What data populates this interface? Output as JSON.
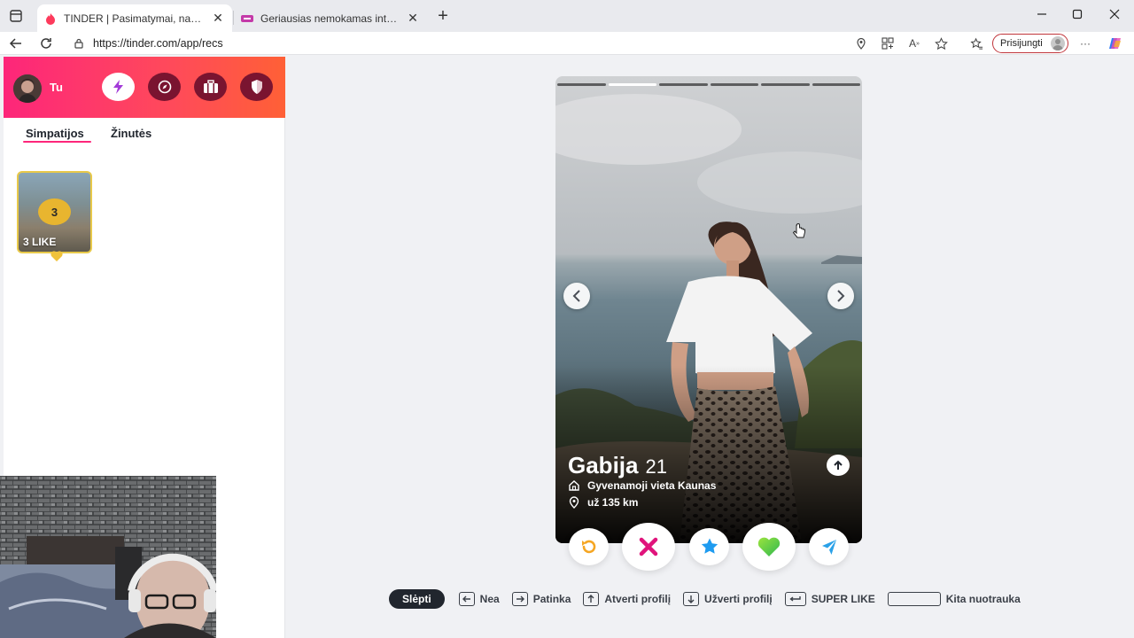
{
  "browser": {
    "tabs": [
      {
        "title": "TINDER | Pasimatymai, nauji draugai",
        "active": true
      },
      {
        "title": "Geriausias nemokamas internetinis",
        "active": false
      }
    ],
    "url": "https://tinder.com/app/recs",
    "signin_label": "Prisijungti"
  },
  "sidebar": {
    "user_name": "Tu",
    "header_buttons": [
      "boost-icon",
      "explore-icon",
      "briefcase-icon",
      "shield-icon"
    ],
    "tabs": [
      {
        "label": "Simpatijos",
        "active": true
      },
      {
        "label": "Žinutės",
        "active": false
      }
    ],
    "likes_card": {
      "count": "3",
      "label": "3 LIKE"
    }
  },
  "card": {
    "name": "Gabija",
    "age": "21",
    "lives_in": "Gyvenamoji vieta Kaunas",
    "distance": "už 135 km",
    "photo_count": 6,
    "active_photo": 1
  },
  "actions": [
    "rewind-icon",
    "nope-icon",
    "super-like-icon",
    "like-icon",
    "boost-icon"
  ],
  "shortcuts": {
    "hide_label": "Slėpti",
    "items": [
      {
        "key": "left-arrow",
        "label": "Nea"
      },
      {
        "key": "right-arrow",
        "label": "Patinka"
      },
      {
        "key": "up-arrow",
        "label": "Atverti profilį"
      },
      {
        "key": "down-arrow",
        "label": "Užverti profilį"
      },
      {
        "key": "enter",
        "label": "SUPER LIKE"
      },
      {
        "key": "space",
        "label": "Kita nuotrauka"
      }
    ]
  },
  "colors": {
    "brand_gradient_start": "#fd267a",
    "brand_gradient_end": "#ff6036",
    "nope": "#e0147c",
    "super_like": "#1e9bf0",
    "like": "#4fd22f",
    "rewind": "#f5a623",
    "boost": "#2aa1e8"
  }
}
